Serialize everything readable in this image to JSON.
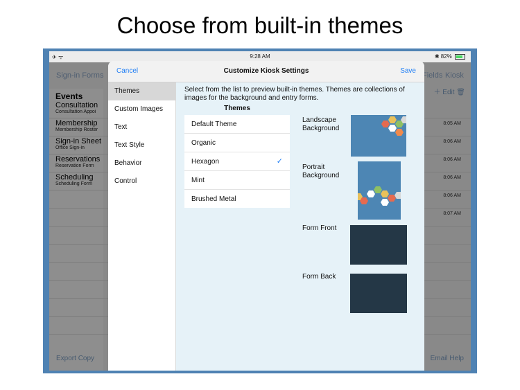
{
  "headline": "Choose from built-in themes",
  "status": {
    "time": "9:28 AM",
    "battery": "82%"
  },
  "background": {
    "nav_left": "Sign-in Forms",
    "nav_right_fields": "Fields",
    "nav_right_kiosk": "Kiosk",
    "edit_label": "Edit",
    "events_title": "Events",
    "events": [
      {
        "name": "Consultation",
        "sub": "Consultation Appoi"
      },
      {
        "name": "Membership",
        "sub": "Membership Roster"
      },
      {
        "name": "Sign-in Sheet",
        "sub": "Office Sign-in"
      },
      {
        "name": "Reservations",
        "sub": "Reservation Form"
      },
      {
        "name": "Scheduling",
        "sub": "Scheduling Form"
      }
    ],
    "times": [
      "8:05 AM",
      "8:06 AM",
      "8:06 AM",
      "8:06 AM",
      "8:06 AM",
      "8:07 AM"
    ],
    "bottom_left_export": "Export",
    "bottom_left_copy": "Copy",
    "bottom_right_email": "Email",
    "bottom_right_help": "Help"
  },
  "modal": {
    "cancel": "Cancel",
    "title": "Customize Kiosk Settings",
    "save": "Save",
    "sidebar": [
      "Themes",
      "Custom Images",
      "Text",
      "Text Style",
      "Behavior",
      "Control"
    ],
    "selected_sidebar": "Themes",
    "description": "Select from the list to preview built-in themes.  Themes are collections of images for the background and entry forms.",
    "themes_header": "Themes",
    "themes": [
      "Default Theme",
      "Organic",
      "Hexagon",
      "Mint",
      "Brushed Metal"
    ],
    "selected_theme": "Hexagon",
    "checkmark": "✓",
    "previews": {
      "landscape_line1": "Landscape",
      "landscape_line2": "Background",
      "portrait_line1": "Portrait",
      "portrait_line2": "Background",
      "form_front": "Form Front",
      "form_back": "Form Back"
    }
  },
  "colors": {
    "accent": "#1f7ef5",
    "device_frame": "#4f82b3",
    "preview_blue": "#4d86b4",
    "form_dark": "#243746"
  },
  "icons": [
    "airplane-icon",
    "wifi-icon",
    "bluetooth-icon",
    "battery-icon",
    "plus-icon",
    "trash-icon",
    "checkmark-icon"
  ]
}
